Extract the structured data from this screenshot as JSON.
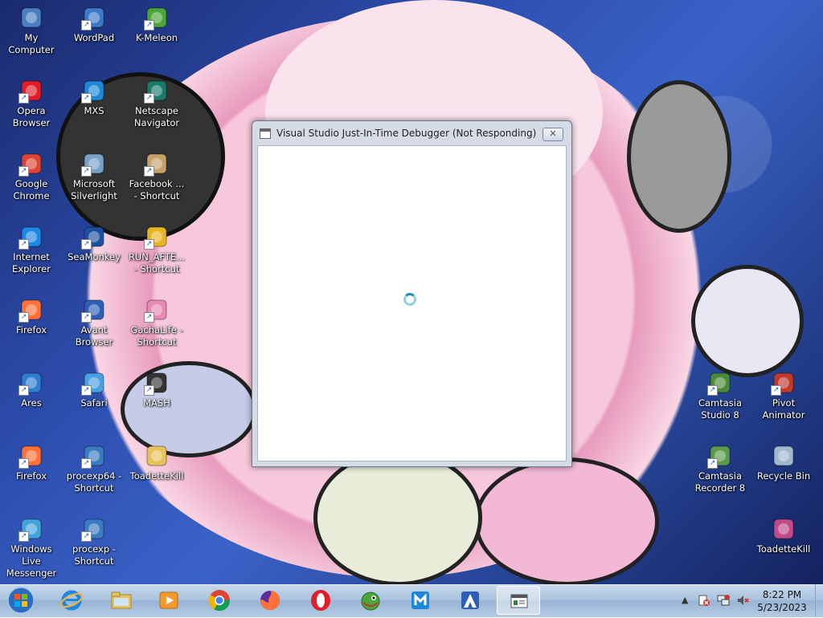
{
  "desktop_icons": [
    {
      "label": "My Computer",
      "icon": "computer-icon"
    },
    {
      "label": "WordPad",
      "icon": "wordpad-icon"
    },
    {
      "label": "K-Meleon",
      "icon": "k-meleon-icon"
    },
    {
      "label": "Opera Browser",
      "icon": "opera-icon"
    },
    {
      "label": "MXS",
      "icon": "maxthon-icon"
    },
    {
      "label": "Netscape Navigator",
      "icon": "netscape-icon"
    },
    {
      "label": "Google Chrome",
      "icon": "chrome-icon"
    },
    {
      "label": "Microsoft Silverlight",
      "icon": "silverlight-icon"
    },
    {
      "label": "Facebook ... - Shortcut",
      "icon": "facebook-icon"
    },
    {
      "label": "Internet Explorer",
      "icon": "ie-icon"
    },
    {
      "label": "SeaMonkey",
      "icon": "seamonkey-icon"
    },
    {
      "label": "RUN_AFTE... - Shortcut",
      "icon": "run-shield-icon"
    },
    {
      "label": "Firefox",
      "icon": "firefox-icon"
    },
    {
      "label": "Avant Browser",
      "icon": "avant-icon"
    },
    {
      "label": "GachaLife - Shortcut",
      "icon": "gachalife-icon"
    },
    {
      "label": "Ares",
      "icon": "ares-icon"
    },
    {
      "label": "Safari",
      "icon": "safari-icon"
    },
    {
      "label": "MASH",
      "icon": "mash-icon"
    },
    {
      "label": "Firefox",
      "icon": "firefox-icon"
    },
    {
      "label": "procexp64 - Shortcut",
      "icon": "procexp-icon"
    },
    {
      "label": "ToadetteKill",
      "icon": "folder-icon"
    },
    {
      "label": "Windows Live Messenger",
      "icon": "messenger-icon"
    },
    {
      "label": "procexp - Shortcut",
      "icon": "procexp-icon"
    },
    {
      "label": "Camtasia Studio 8",
      "icon": "camtasia-icon"
    },
    {
      "label": "Pivot Animator",
      "icon": "pivot-icon"
    },
    {
      "label": "Camtasia Recorder 8",
      "icon": "camtasia-recorder-icon"
    },
    {
      "label": "Recycle Bin",
      "icon": "recycle-bin-icon"
    },
    {
      "label": "ToadetteKill",
      "icon": "toadettekill-icon"
    }
  ],
  "window": {
    "title": "Visual Studio Just-In-Time Debugger (Not Responding)",
    "close_glyph": "✕"
  },
  "taskbar": {
    "items": [
      "start",
      "internet-explorer",
      "file-explorer",
      "media-player",
      "chrome",
      "firefox",
      "opera",
      "k-meleon",
      "maxthon",
      "avant",
      "jit-debugger"
    ]
  },
  "tray": {
    "show_hidden_glyph": "▲",
    "time": "8:22 PM",
    "date": "5/23/2023"
  }
}
